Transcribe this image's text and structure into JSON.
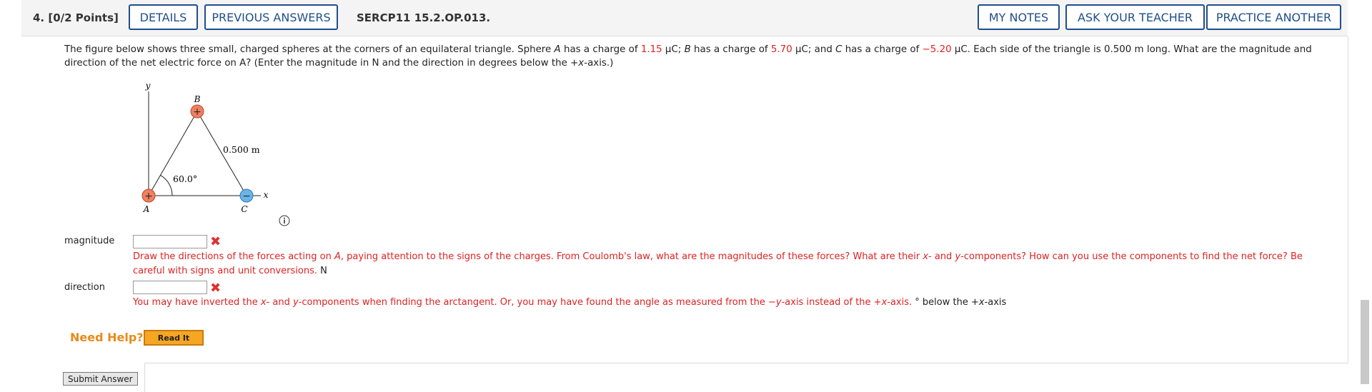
{
  "header": {
    "question_label": "4. [0/2 Points]",
    "details_label": "DETAILS",
    "previous_answers_label": "PREVIOUS ANSWERS",
    "code": "SERCP11 15.2.OP.013.",
    "my_notes_label": "MY NOTES",
    "ask_teacher_label": "ASK YOUR TEACHER",
    "practice_another_label": "PRACTICE ANOTHER"
  },
  "problem": {
    "t1": "The figure below shows three small, charged spheres at the corners of an equilateral triangle. Sphere ",
    "a": "A",
    "t2": " has a charge of ",
    "qa": "1.15",
    "t3": " μC; ",
    "b": "B",
    "t4": " has a charge of ",
    "qb": "5.70",
    "t5": " μC; and ",
    "c": "C",
    "t6": " has a charge of ",
    "qc": "−5.20",
    "t7": " μC. Each side of the triangle is 0.500 m long. What are the magnitude and direction of the net electric force on A? (Enter the magnitude in N and the direction in degrees below the +",
    "x": "x",
    "t8": "-axis.)"
  },
  "figure": {
    "y_axis": "y",
    "x_axis": "x",
    "label_a": "A",
    "label_b": "B",
    "label_c": "C",
    "side_length": "0.500 m",
    "angle": "60.0°",
    "plus": "+",
    "minus": "−",
    "colors": {
      "positive": "#f08060",
      "negative": "#6ab4e8"
    }
  },
  "magnitude": {
    "label": "magnitude",
    "value": "",
    "feedback_a": "Draw the directions of the forces acting on ",
    "fa_it": "A",
    "feedback_b": ", paying attention to the signs of the charges. From Coulomb's law, what are the magnitudes of these forces? What are their ",
    "fb_x": "x",
    "feedback_c": "- and ",
    "fb_y": "y",
    "feedback_d": "-components? How can you use the components to find the net force? Be careful with signs and unit conversions.",
    "unit": " N"
  },
  "direction": {
    "label": "direction",
    "value": "",
    "feedback_a": "You may have inverted the ",
    "fa_x": "x",
    "feedback_b": "- and ",
    "fa_y": "y",
    "feedback_c": "-components when finding the arctangent. Or, you may have found the angle as measured from the −",
    "fc_y": "y",
    "feedback_d": "-axis instead of the +",
    "fd_x": "x",
    "feedback_e": "-axis.",
    "unit_a": " ° below the +",
    "unit_x": "x",
    "unit_b": "-axis"
  },
  "help": {
    "need_help": "Need Help?",
    "read_it": "Read It"
  },
  "submit_label": "Submit Answer"
}
